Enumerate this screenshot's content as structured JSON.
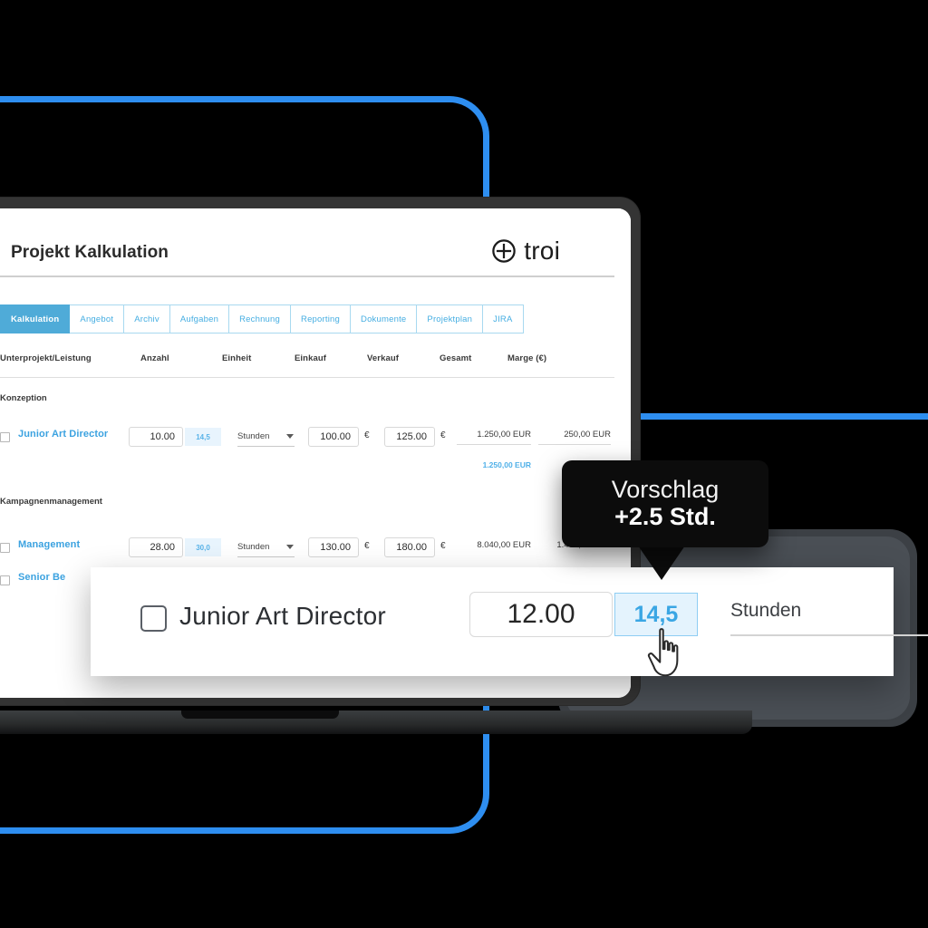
{
  "app": {
    "page_title": "Projekt Kalkulation",
    "brand": {
      "name": "troi",
      "logo_icon": "circle-plus-icon"
    }
  },
  "tabs": [
    {
      "label": "Kalkulation",
      "active": true
    },
    {
      "label": "Angebot",
      "active": false
    },
    {
      "label": "Archiv",
      "active": false
    },
    {
      "label": "Aufgaben",
      "active": false
    },
    {
      "label": "Rechnung",
      "active": false
    },
    {
      "label": "Reporting",
      "active": false
    },
    {
      "label": "Dokumente",
      "active": false
    },
    {
      "label": "Projektplan",
      "active": false
    },
    {
      "label": "JIRA",
      "active": false
    }
  ],
  "table": {
    "columns": [
      "Unterprojekt/Leistung",
      "Anzahl",
      "Einheit",
      "Einkauf",
      "Verkauf",
      "Gesamt",
      "Marge (€)"
    ],
    "groups": [
      {
        "label": "Konzeption"
      },
      {
        "label": "Kampagnenmanagement"
      }
    ],
    "rows": [
      {
        "name": "Junior Art Director",
        "anzahl": "10.00",
        "hint": "14,5",
        "einheit": "Stunden",
        "einkauf": "100.00",
        "einkauf_currency": "€",
        "verkauf": "125.00",
        "verkauf_currency": "€",
        "gesamt": "1.250,00 EUR",
        "marge": "250,00 EUR",
        "gesamt_subtotal": "1.250,00 EUR"
      },
      {
        "name": "Management",
        "anzahl": "28.00",
        "hint": "30,0",
        "einheit": "Stunden",
        "einkauf": "130.00",
        "einkauf_currency": "€",
        "verkauf": "180.00",
        "verkauf_currency": "€",
        "gesamt": "8.040,00 EUR",
        "marge": "1.400,00 EUR",
        "gesamt_subtotal": ""
      },
      {
        "name": "Senior Be",
        "anzahl": "",
        "hint": "",
        "einheit": "",
        "einkauf": "",
        "einkauf_currency": "",
        "verkauf": "",
        "verkauf_currency": "",
        "gesamt": "",
        "marge": "",
        "gesamt_subtotal": ""
      }
    ]
  },
  "front_card": {
    "name": "Junior Art Director",
    "quantity": "12.00",
    "suggested_value": "14,5",
    "unit": "Stunden",
    "caret_icon": "chevron-down-icon",
    "cursor_icon": "pointing-hand-cursor"
  },
  "tooltip": {
    "line1": "Vorschlag",
    "line2": "+2.5 Std."
  },
  "colors": {
    "accent_blue": "#2e8ef0",
    "tab_active": "#4fabd8",
    "link_blue": "#3ba2e0",
    "hint_bg": "#e4f3fd",
    "hint_text": "#3aa6e4",
    "frame_dark": "#343434"
  }
}
